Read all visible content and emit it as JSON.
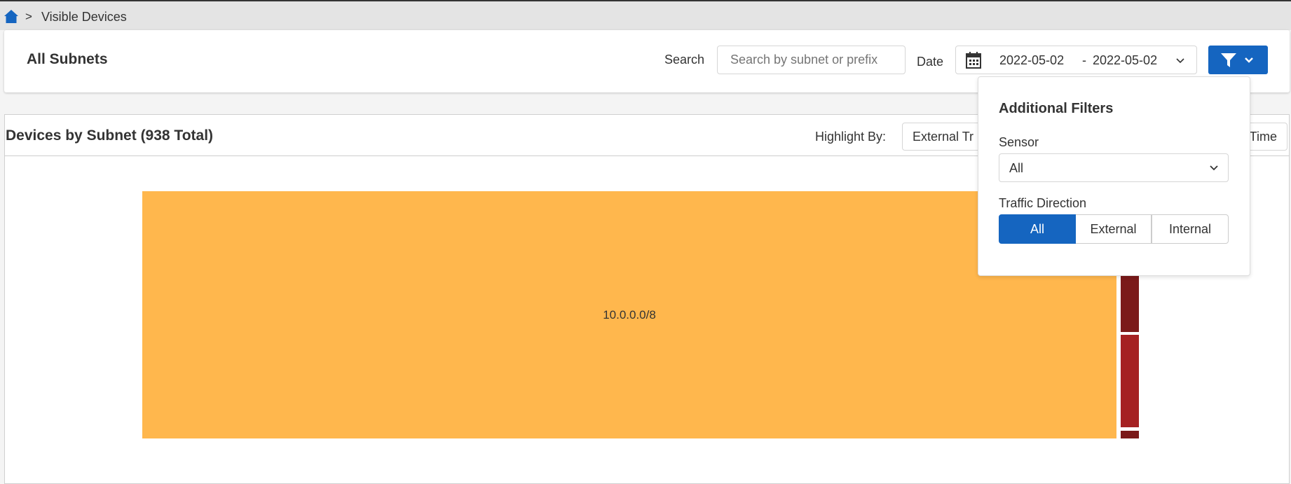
{
  "breadcrumb": {
    "separator": ">",
    "current": "Visible Devices"
  },
  "header": {
    "title": "All Subnets",
    "search_label": "Search",
    "search_placeholder": "Search by subnet or prefix",
    "date_label": "Date",
    "date_start": "2022-05-02",
    "date_sep": "-",
    "date_end": "2022-05-02"
  },
  "panel": {
    "title": "Devices by Subnet (938 Total)",
    "highlight_label": "Highlight By:",
    "highlight_value_left": "External Tr",
    "highlight_value_right": "Time"
  },
  "filters": {
    "title": "Additional Filters",
    "sensor_label": "Sensor",
    "sensor_value": "All",
    "direction_label": "Traffic Direction",
    "direction_options": [
      "All",
      "External",
      "Internal"
    ],
    "direction_selected": "All"
  },
  "treemap": {
    "tiles": [
      {
        "label": "10.0.0.0/8",
        "color": "#ffb74d"
      },
      {
        "label": "",
        "color": "#7b1a1a"
      },
      {
        "label": "",
        "color": "#a52122"
      },
      {
        "label": "",
        "color": "#7b1a1a"
      }
    ]
  },
  "colors": {
    "accent": "#1565c0"
  }
}
